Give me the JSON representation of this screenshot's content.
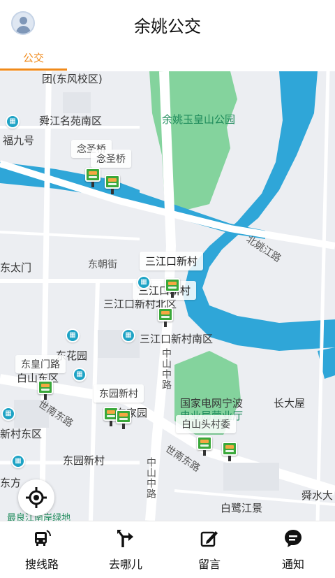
{
  "header": {
    "title": "余姚公交",
    "avatar_icon": "user-avatar-icon"
  },
  "tabs": [
    {
      "label": "公交",
      "active": true
    }
  ],
  "colors": {
    "accent": "#f08a1a",
    "water": "#2fa6d8",
    "park": "#7fd09a",
    "stop": "#3aa83a"
  },
  "map": {
    "labels": {
      "dongfeng_school": "团(东风校区)",
      "shunjiang_mingyuan": "舜江名苑南区",
      "fujiu": "福九号",
      "park": "余姚玉皇山公园",
      "beiyao_road": "北姚江路",
      "dongtaimen": "东太门",
      "dongchao_street": "东朝街",
      "sanjiangkou_north": "三江口新村北区",
      "sanjiangkou_south": "三江口新村南区",
      "donghuayuan": "东花园",
      "baishan_east": "白山东区",
      "shinan_east_road": "世南东路",
      "xincun_east": "新村东区",
      "dongyuan_xincun": "东园新村",
      "dongfang": "东方",
      "zhongshan_middle_road": "中山中路",
      "zhongshan_road_lower": "中山中路",
      "state_grid": "国家电网宁波",
      "business_hall": "电业局营业厅",
      "dadawu": "长大屋",
      "baishantou": "白山头村委",
      "shinan_road_2": "世南东路",
      "shunshui": "舜水大",
      "bailujiang": "白鹭江景",
      "riverside_green": "最良江南岸绿地",
      "gongyuan": "东家园"
    },
    "bubbles": {
      "niansheng_1": "念圣桥",
      "niansheng_2": "念圣桥",
      "sanjiangkou_1": "三江口新村",
      "sanjiangkou_2": "三江口新村",
      "donghuangmen": "东皇门路",
      "dongyuan": "东园新村",
      "baishantou_bubble": "白山头村委"
    }
  },
  "locate_button": {
    "icon": "locate-crosshair-icon"
  },
  "bottom_nav": [
    {
      "label": "搜线路",
      "icon": "bus-search-icon"
    },
    {
      "label": "去哪儿",
      "icon": "route-turn-icon"
    },
    {
      "label": "留言",
      "icon": "edit-note-icon"
    },
    {
      "label": "通知",
      "icon": "chat-notice-icon"
    }
  ]
}
